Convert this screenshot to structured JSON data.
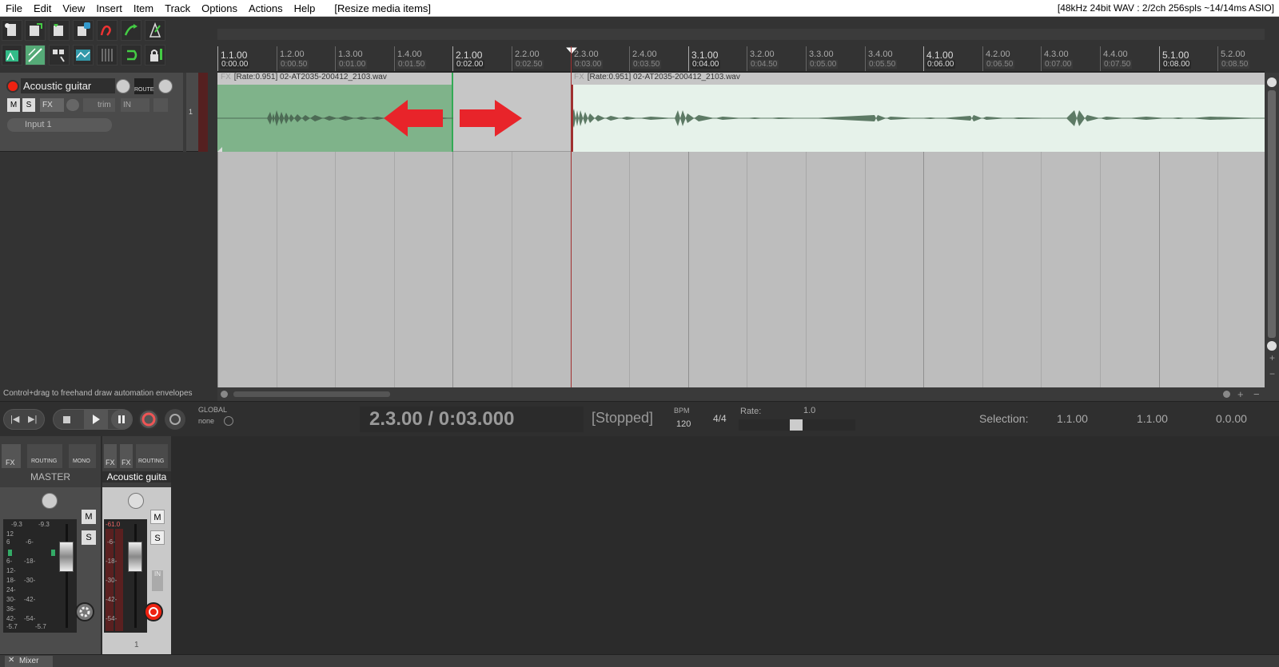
{
  "menu": [
    "File",
    "Edit",
    "View",
    "Insert",
    "Item",
    "Track",
    "Options",
    "Actions",
    "Help"
  ],
  "menu_action_status": "[Resize media items]",
  "audio_status": "[48kHz 24bit WAV : 2/2ch 256spls ~14/14ms ASIO]",
  "ruler": {
    "ticks": [
      {
        "bar": "1.1.00",
        "time": "0:00.00",
        "major": true
      },
      {
        "bar": "1.2.00",
        "time": "0:00.50",
        "major": false
      },
      {
        "bar": "1.3.00",
        "time": "0:01.00",
        "major": false
      },
      {
        "bar": "1.4.00",
        "time": "0:01.50",
        "major": false
      },
      {
        "bar": "2.1.00",
        "time": "0:02.00",
        "major": true
      },
      {
        "bar": "2.2.00",
        "time": "0:02.50",
        "major": false
      },
      {
        "bar": "2.3.00",
        "time": "0:03.00",
        "major": false
      },
      {
        "bar": "2.4.00",
        "time": "0:03.50",
        "major": false
      },
      {
        "bar": "3.1.00",
        "time": "0:04.00",
        "major": true
      },
      {
        "bar": "3.2.00",
        "time": "0:04.50",
        "major": false
      },
      {
        "bar": "3.3.00",
        "time": "0:05.00",
        "major": false
      },
      {
        "bar": "3.4.00",
        "time": "0:05.50",
        "major": false
      },
      {
        "bar": "4.1.00",
        "time": "0:06.00",
        "major": true
      },
      {
        "bar": "4.2.00",
        "time": "0:06.50",
        "major": false
      },
      {
        "bar": "4.3.00",
        "time": "0:07.00",
        "major": false
      },
      {
        "bar": "4.4.00",
        "time": "0:07.50",
        "major": false
      },
      {
        "bar": "5.1.00",
        "time": "0:08.00",
        "major": true
      },
      {
        "bar": "5.2.00",
        "time": "0:08.50",
        "major": false
      }
    ]
  },
  "track": {
    "name": "Acoustic guitar",
    "route_label": "ROUTE",
    "mute": "M",
    "solo": "S",
    "fx": "FX",
    "trim": "trim",
    "in": "IN",
    "input": "Input 1",
    "number": "1"
  },
  "items": [
    {
      "fx": "FX",
      "label": "[Rate:0.951] 02-AT2035-200412_2103.wav",
      "color": "#7fb38a"
    },
    {
      "fx": "FX",
      "label": "[Rate:0.951] 02-AT2035-200412_2103.wav",
      "color": "#e6f2ea"
    }
  ],
  "arrow_color": "#e8242a",
  "hint": "Control+drag to freehand draw automation envelopes",
  "transport": {
    "global_label": "GLOBAL",
    "global_value": "none",
    "position": "2.3.00 / 0:03.000",
    "state": "[Stopped]",
    "bpm_label": "BPM",
    "bpm": "120",
    "timesig": "4/4",
    "rate_label": "Rate:",
    "rate": "1.0",
    "selection_label": "Selection:",
    "sel_start": "1.1.00",
    "sel_end": "1.1.00",
    "sel_len": "0.0.00"
  },
  "mixer": {
    "master": {
      "name": "MASTER",
      "fx": "FX",
      "routing": "ROUTING",
      "mono": "MONO",
      "peak_l": "-9.3",
      "peak_r": "-9.3",
      "m": "M",
      "s": "S",
      "scale": [
        "12",
        "6",
        "6-",
        "12-",
        "18-",
        "24-",
        "30-",
        "36-",
        "42-"
      ],
      "mid_scale": [
        "-6-",
        "-18-",
        "-30-",
        "-42-",
        "-54-"
      ],
      "bottom_l": "-5.7",
      "bottom_r": "-5.7"
    },
    "track": {
      "name": "Acoustic guita",
      "fx": "FX",
      "in_fx": "FX",
      "routing": "ROUTING",
      "peak": "-61.0",
      "m": "M",
      "s": "S",
      "in": "IN",
      "mid_scale": [
        "-6-",
        "-18-",
        "-30-",
        "-42-",
        "-54-"
      ],
      "number": "1"
    }
  },
  "mixer_tab": "Mixer"
}
